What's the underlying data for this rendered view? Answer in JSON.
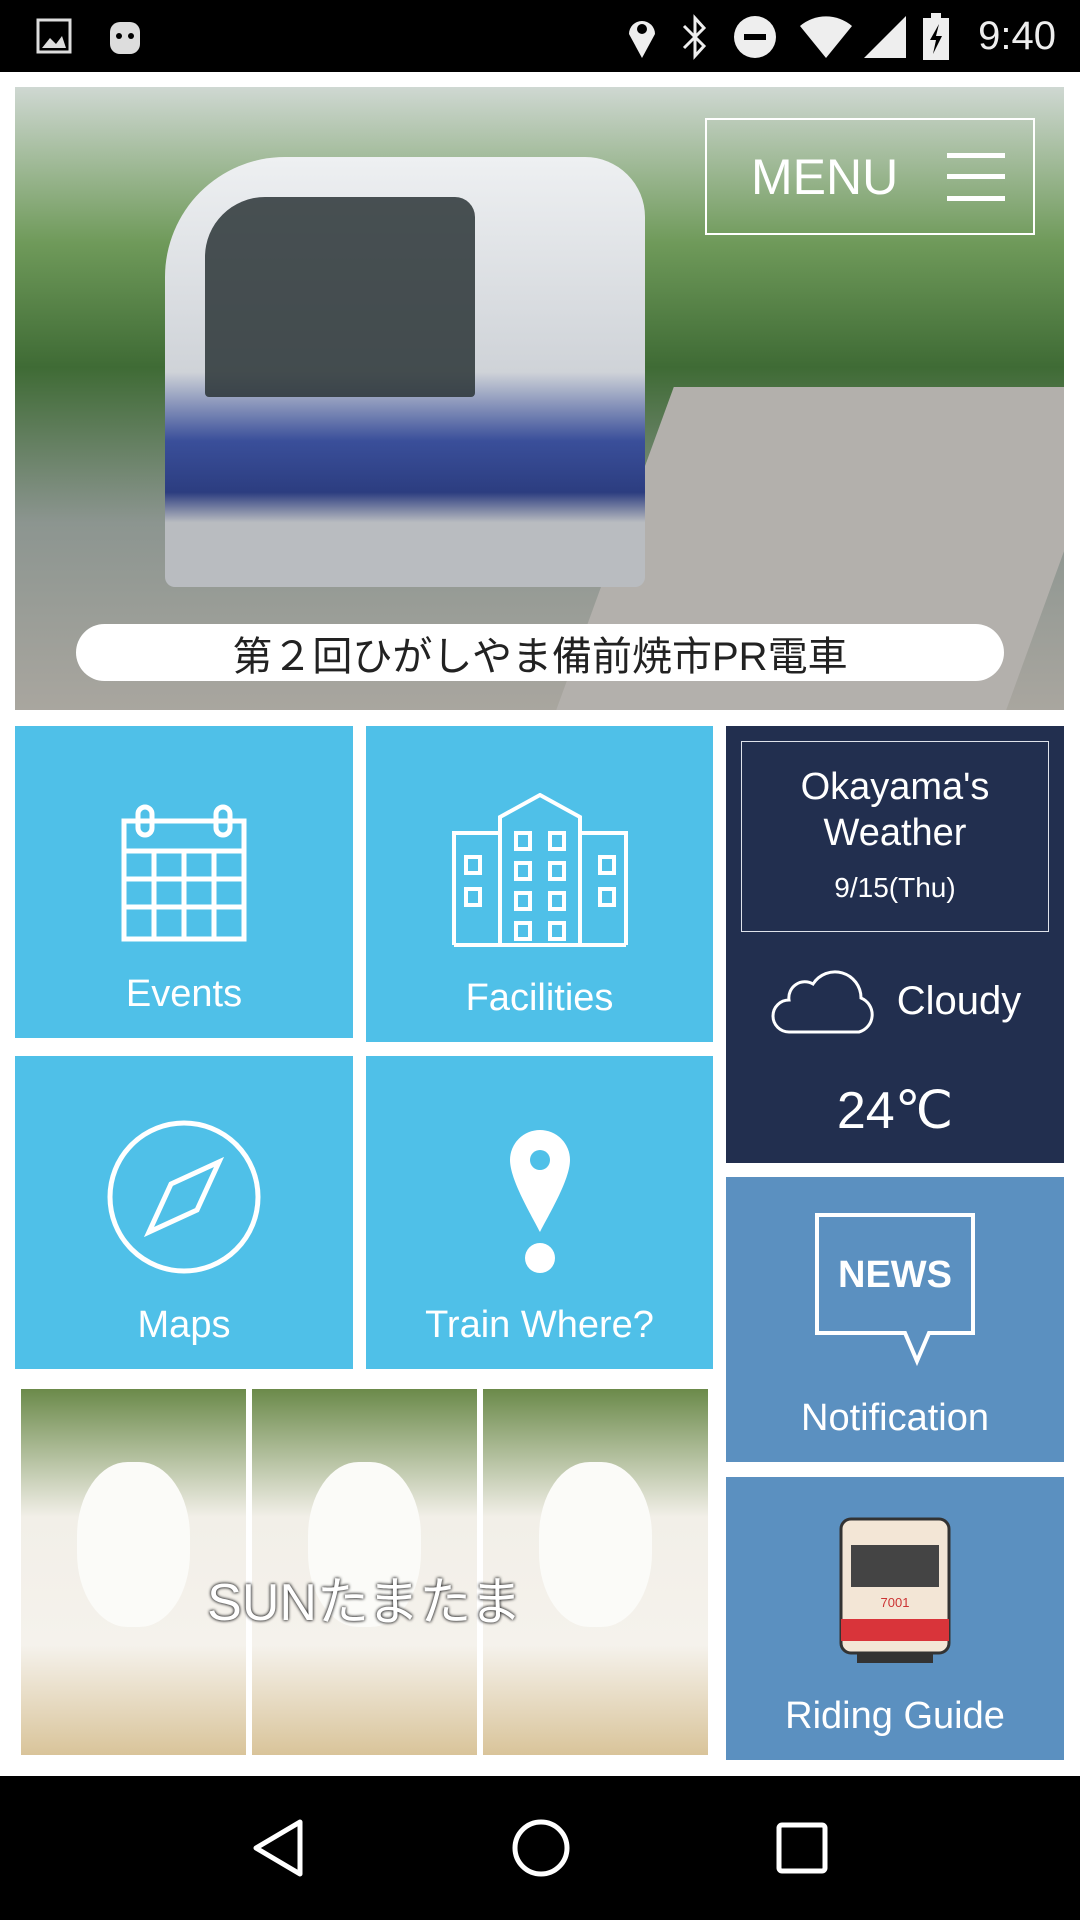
{
  "status_bar": {
    "time": "9:40",
    "icons": [
      "image-icon",
      "android-icon",
      "location-icon",
      "bluetooth-icon",
      "do-not-disturb-icon",
      "wifi-icon",
      "signal-icon",
      "battery-charging-icon"
    ]
  },
  "hero": {
    "caption": "第２回ひがしやま備前焼市PR電車",
    "menu_label": "MENU"
  },
  "tiles": {
    "events": "Events",
    "facilities": "Facilities",
    "maps": "Maps",
    "train_where": "Train Where?",
    "notification": "Notification",
    "news_icon_text": "NEWS",
    "riding_guide": "Riding Guide",
    "tram_number": "7001"
  },
  "weather": {
    "title_line1": "Okayama's",
    "title_line2": "Weather",
    "date": "9/15(Thu)",
    "condition": "Cloudy",
    "temperature": "24℃"
  },
  "banner": {
    "label": "SUNたまたま"
  },
  "colors": {
    "tile": "#4fc0e8",
    "weather": "#222f4f",
    "secondary_tile": "#5b90c0"
  }
}
